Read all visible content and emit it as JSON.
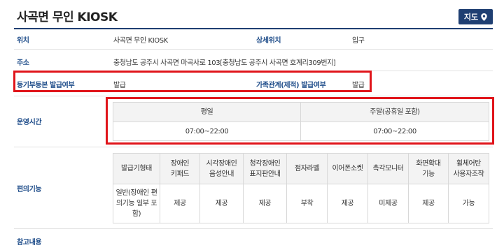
{
  "header": {
    "title": "사곡면 무인 KIOSK",
    "map_button": "지도"
  },
  "info": {
    "location_label": "위치",
    "location_value": "사곡면 무인 KIOSK",
    "detail_location_label": "상세위치",
    "detail_location_value": "입구",
    "address_label": "주소",
    "address_value": "충청남도 공주시 사곡면 마곡사로 103[충청남도 공주시 사곡면 호계리309번지]",
    "registry_label": "등기부등본 발급여부",
    "registry_value": "발급",
    "family_label": "가족관계(제적) 발급여부",
    "family_value": "발급"
  },
  "hours": {
    "label": "운영시간",
    "columns": [
      "평일",
      "주말(공휴일 포함)"
    ],
    "values": [
      "07:00~22:00",
      "07:00~22:00"
    ]
  },
  "convenience": {
    "label": "편의기능",
    "headers": [
      [
        "발급기형태"
      ],
      [
        "장애인",
        "키패드"
      ],
      [
        "시각장애인",
        "음성안내"
      ],
      [
        "청각장애인",
        "표지판안내"
      ],
      [
        "점자라벨"
      ],
      [
        "이어폰소켓"
      ],
      [
        "촉각모니터"
      ],
      [
        "화면확대",
        "기능"
      ],
      [
        "휠체어탄",
        "사용자조작"
      ]
    ],
    "values": [
      [
        "일반(장애인 편",
        "의기능 일부 포",
        "함)"
      ],
      [
        "제공"
      ],
      [
        "제공"
      ],
      [
        "제공"
      ],
      [
        "부착"
      ],
      [
        "제공"
      ],
      [
        "미제공"
      ],
      [
        "제공"
      ],
      [
        "가능"
      ]
    ]
  },
  "reference": {
    "label": "참고내용"
  },
  "colors": {
    "accent": "#1f3f72",
    "label": "#1f4d8a",
    "highlight": "#e0141a"
  },
  "icons": {
    "map": "map-pin-icon"
  }
}
